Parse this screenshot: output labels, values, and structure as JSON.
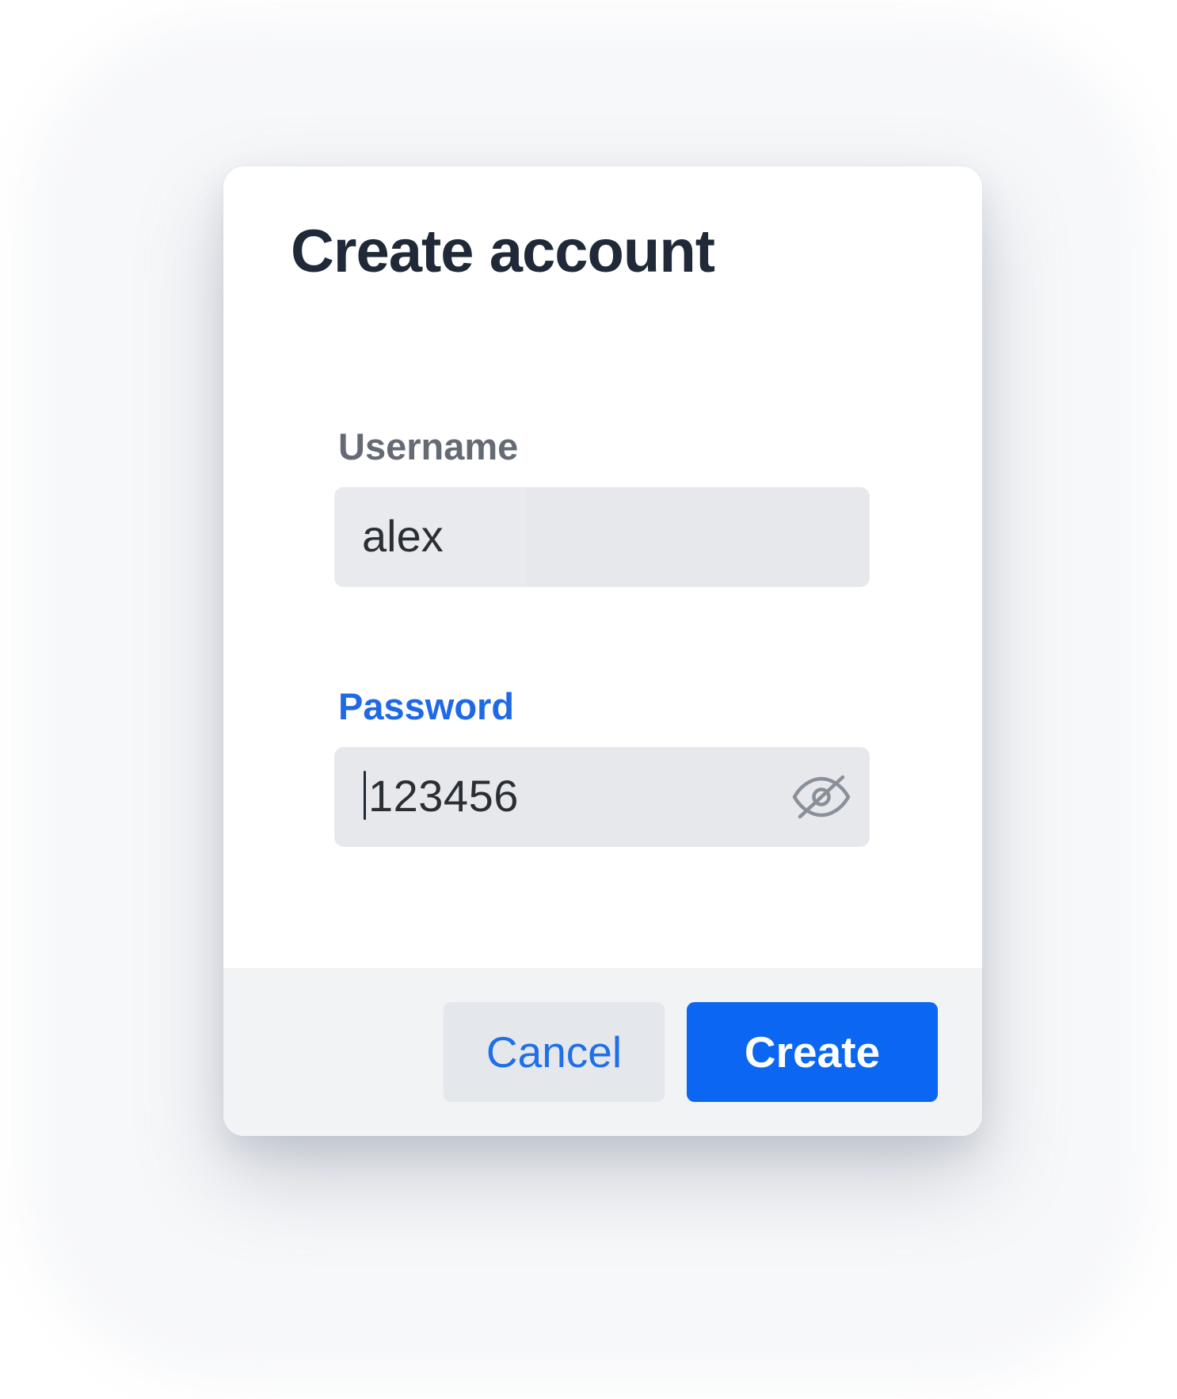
{
  "dialog": {
    "title": "Create account"
  },
  "form": {
    "username": {
      "label": "Username",
      "value": "alex"
    },
    "password": {
      "label": "Password",
      "value": "123456",
      "visibility_icon": "eye-off-icon"
    }
  },
  "actions": {
    "cancel_label": "Cancel",
    "create_label": "Create"
  },
  "colors": {
    "accent": "#0b67f1",
    "focus_label": "#1f69e6",
    "field_background": "#e7e8eb",
    "footer_background": "#f1f3f5",
    "title_text": "#1f2937"
  }
}
